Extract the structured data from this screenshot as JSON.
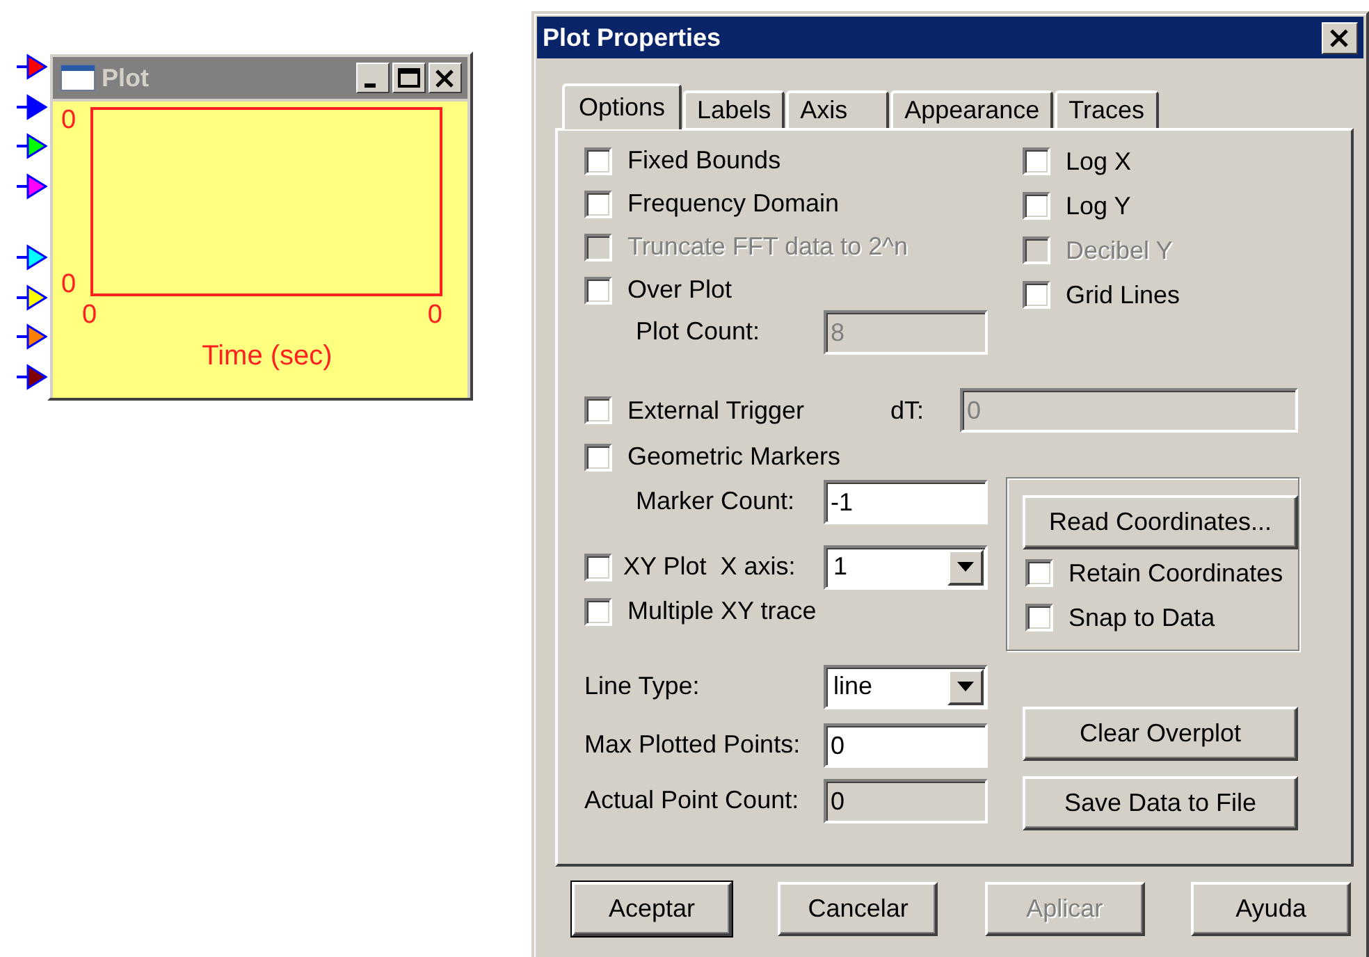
{
  "plot_block": {
    "title": "Plot",
    "inputs": [
      {
        "color": "#ff0000"
      },
      {
        "color": "#0000ff"
      },
      {
        "color": "#00ff00"
      },
      {
        "color": "#ff00ff"
      },
      {
        "color": "#00ffff"
      },
      {
        "color": "#ffff00"
      },
      {
        "color": "#ff8000"
      },
      {
        "color": "#800000"
      }
    ],
    "y_labels": [
      "0",
      "0"
    ],
    "x_labels": [
      "0",
      "0"
    ],
    "xlabel": "Time (sec)"
  },
  "dialog": {
    "title": "Plot Properties",
    "tabs": [
      {
        "label": "Options",
        "selected": true
      },
      {
        "label": "Labels",
        "selected": false
      },
      {
        "label": "Axis",
        "selected": false
      },
      {
        "label": "Appearance",
        "selected": false
      },
      {
        "label": "Traces",
        "selected": false
      }
    ],
    "left_checks": [
      {
        "label": "Fixed Bounds",
        "checked": false,
        "disabled": false
      },
      {
        "label": "Frequency Domain",
        "checked": false,
        "disabled": false
      },
      {
        "label": "Truncate FFT data to 2^n",
        "checked": false,
        "disabled": true
      },
      {
        "label": "Over Plot",
        "checked": false,
        "disabled": false
      }
    ],
    "plot_count": {
      "label": "Plot Count:",
      "value": "8",
      "disabled": true
    },
    "right_checks": [
      {
        "label": "Log X",
        "checked": false,
        "disabled": false
      },
      {
        "label": "Log Y",
        "checked": false,
        "disabled": false
      },
      {
        "label": "Decibel Y",
        "checked": false,
        "disabled": true
      },
      {
        "label": "Grid Lines",
        "checked": false,
        "disabled": false
      }
    ],
    "external_trigger": {
      "label": "External Trigger",
      "checked": false,
      "disabled": false
    },
    "dt": {
      "label": "dT:",
      "value": "0",
      "disabled": true
    },
    "geometric_markers": {
      "label": "Geometric Markers",
      "checked": false,
      "disabled": false
    },
    "marker_count": {
      "label": "Marker Count:",
      "value": "-1",
      "disabled": false
    },
    "xy_plot": {
      "label": "XY Plot  X axis:",
      "checked": false,
      "disabled": false
    },
    "x_axis": {
      "value": "1"
    },
    "multiple_xy": {
      "label": "Multiple XY trace",
      "checked": false,
      "disabled": false
    },
    "line_type": {
      "label": "Line Type:",
      "value": "line"
    },
    "max_points": {
      "label": "Max Plotted Points:",
      "value": "0",
      "disabled": false
    },
    "actual_points": {
      "label": "Actual Point Count:",
      "value": "0",
      "readonly": true
    },
    "coordinates": {
      "button": "Read Coordinates...",
      "checks": [
        {
          "label": "Retain Coordinates",
          "checked": false,
          "disabled": false
        },
        {
          "label": "Snap to Data",
          "checked": false,
          "disabled": false
        }
      ]
    },
    "action_buttons": [
      "Clear Overplot",
      "Save Data to File"
    ],
    "buttons": [
      {
        "label": "Aceptar",
        "default": true,
        "disabled": false
      },
      {
        "label": "Cancelar",
        "default": false,
        "disabled": false
      },
      {
        "label": "Aplicar",
        "default": false,
        "disabled": true
      },
      {
        "label": "Ayuda",
        "default": false,
        "disabled": false
      }
    ]
  }
}
